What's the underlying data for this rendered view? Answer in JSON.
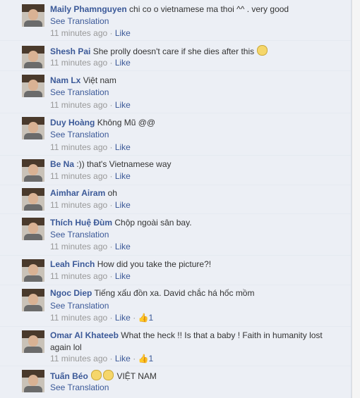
{
  "comments": [
    {
      "author": "Maily Phamnguyen",
      "text": "chi co o vietnamese ma thoi ^^ . very good",
      "translate": "See Translation",
      "time": "11 minutes ago",
      "sep": " · ",
      "like": "Like"
    },
    {
      "author": "Shesh Pai",
      "text": "She prolly doesn't care if she dies after this",
      "time": "11 minutes ago",
      "sep": " · ",
      "like": "Like"
    },
    {
      "author": "Nam Lx",
      "text": "Việt nam",
      "translate": "See Translation",
      "time": "11 minutes ago",
      "sep": " · ",
      "like": "Like"
    },
    {
      "author": "Duy Hoàng",
      "text": "Không Mũ @@",
      "translate": "See Translation",
      "time": "11 minutes ago",
      "sep": " · ",
      "like": "Like"
    },
    {
      "author": "Be Na",
      "text": ":)) that's Vietnamese way",
      "time": "11 minutes ago",
      "sep": " · ",
      "like": "Like"
    },
    {
      "author": "Aimhar Airam",
      "text": "oh",
      "time": "11 minutes ago",
      "sep": " · ",
      "like": "Like"
    },
    {
      "author": "Thích Huệ Đùm",
      "text": "Chộp ngoài sân bay.",
      "translate": "See Translation",
      "time": "11 minutes ago",
      "sep": " · ",
      "like": "Like"
    },
    {
      "author": "Leah Finch",
      "text": "How did you take the picture?!",
      "time": "11 minutes ago",
      "sep": " · ",
      "like": "Like"
    },
    {
      "author": "Ngoc Diep",
      "text": "Tiếng xấu đồn xa. David chắc há hốc mồm",
      "translate": "See Translation",
      "time": "11 minutes ago",
      "sep": " · ",
      "like": "Like",
      "sep2": " · ",
      "likes": "1"
    },
    {
      "author": "Omar Al Khateeb",
      "text": "What the heck !! Is that a baby ! Faith in humanity lost again lol",
      "time": "11 minutes ago",
      "sep": " · ",
      "like": "Like",
      "sep2": " · ",
      "likes": "1"
    },
    {
      "author": "Tuấn Béo",
      "text": "VIỆT NAM",
      "translate": "See Translation"
    }
  ],
  "icons": {
    "thumbs_up": "thumbs-up-icon",
    "emoji": "smiley-icon"
  }
}
